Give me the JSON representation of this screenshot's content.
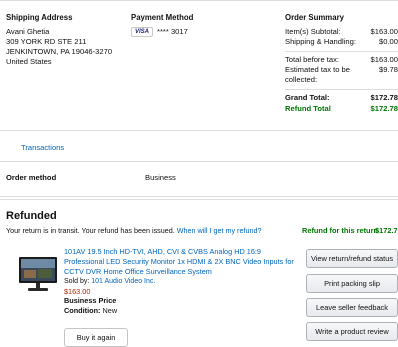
{
  "shipping": {
    "heading": "Shipping Address",
    "lines": [
      "Avani Ghetia",
      "309 YORK RD STE 211",
      "JENKINTOWN, PA 19046-3270",
      "United States"
    ]
  },
  "payment": {
    "heading": "Payment Method",
    "card_brand": "VISA",
    "card_mask": "**** 3017"
  },
  "summary": {
    "heading": "Order Summary",
    "items_label": "Item(s) Subtotal:",
    "items_value": "$163.00",
    "shipping_label": "Shipping & Handling:",
    "shipping_value": "$0.00",
    "before_tax_label": "Total before tax:",
    "before_tax_value": "$163.00",
    "tax_label": "Estimated tax to be collected:",
    "tax_value": "$9.78",
    "grand_label": "Grand Total:",
    "grand_value": "$172.78",
    "refund_label": "Refund Total",
    "refund_value": "$172.78"
  },
  "transactions": {
    "link": "Transactions"
  },
  "order_method": {
    "label": "Order method",
    "value": "Business"
  },
  "refund_section": {
    "title": "Refunded",
    "message": "Your return is in transit. Your refund has been issued.",
    "help_link": "When will I get my refund?",
    "refund_label": "Refund for this return",
    "refund_value": "$172.78"
  },
  "product": {
    "title": "101AV 19.5 Inch HD-TVI, AHD, CVI & CVBS Analog HD 16:9 Professional LED Security Monitor 1x HDMI & 2X BNC Video Inputs for CCTV DVR Home Office Surveillance System",
    "sold_by_prefix": "Sold by:",
    "seller": "101 Audio Video Inc.",
    "price": "$163.00",
    "business_price": "Business Price",
    "condition_label": "Condition:",
    "condition_value": "New",
    "buy_again": "Buy it again"
  },
  "actions": {
    "view_status": "View return/refund status",
    "print_slip": "Print packing slip",
    "seller_feedback": "Leave seller feedback",
    "review": "Write a product review"
  },
  "colors": {
    "link": "#0066c0",
    "green": "#007600",
    "price": "#b12704"
  }
}
